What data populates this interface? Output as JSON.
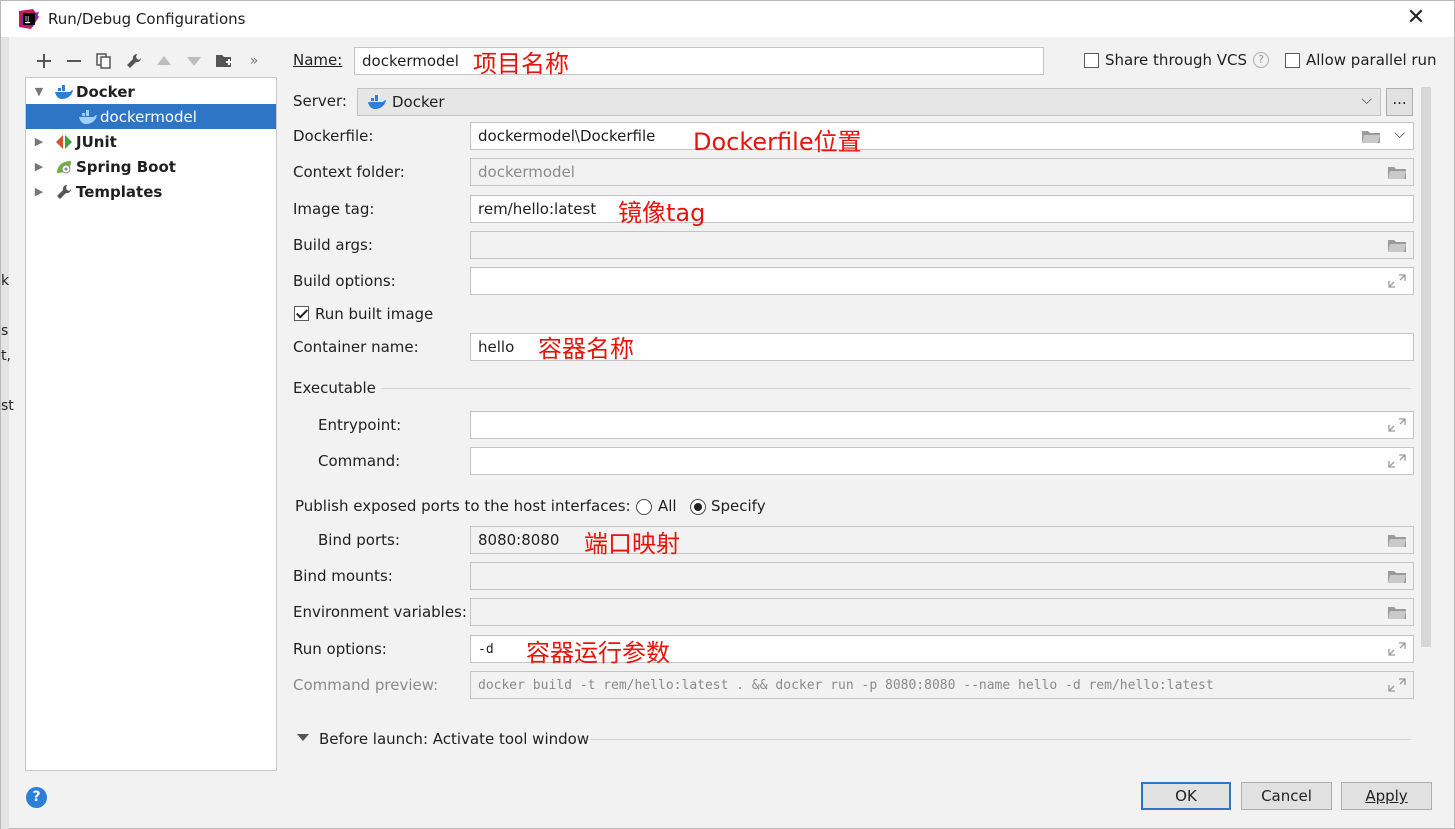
{
  "window": {
    "title": "Run/Debug Configurations"
  },
  "tree": {
    "items": [
      {
        "label": "Docker"
      },
      {
        "label": "dockermodel"
      },
      {
        "label": "JUnit"
      },
      {
        "label": "Spring Boot"
      },
      {
        "label": "Templates"
      }
    ]
  },
  "header": {
    "name_label": "Name:",
    "name_value": "dockermodel",
    "share_label": "Share through VCS",
    "parallel_label": "Allow parallel run"
  },
  "form": {
    "server_label": "Server:",
    "server_value": "Docker",
    "dockerfile_label": "Dockerfile:",
    "dockerfile_value": "dockermodel\\Dockerfile",
    "context_label": "Context folder:",
    "context_value": "dockermodel",
    "imagetag_label": "Image tag:",
    "imagetag_value": "rem/hello:latest",
    "buildargs_label": "Build args:",
    "buildoptions_label": "Build options:",
    "runbuilt_label": "Run built image",
    "container_label": "Container name:",
    "container_value": "hello",
    "executable_label": "Executable",
    "entrypoint_label": "Entrypoint:",
    "command_label": "Command:",
    "publish_label": "Publish exposed ports to the host interfaces:",
    "radio_all": "All",
    "radio_specify": "Specify",
    "bindports_label": "Bind ports:",
    "bindports_value": "8080:8080",
    "bindmounts_label": "Bind mounts:",
    "envvars_label": "Environment variables:",
    "runoptions_label": "Run options:",
    "runoptions_value": "-d",
    "preview_label": "Command preview:",
    "preview_value": "docker build -t rem/hello:latest . && docker run -p 8080:8080 --name hello -d rem/hello:latest",
    "before_launch_label": "Before launch: Activate tool window",
    "more_button": "..."
  },
  "annotations": {
    "name": "项目名称",
    "dockerfile": "Dockerfile位置",
    "imagetag": "镜像tag",
    "container": "容器名称",
    "bindports": "端口映射",
    "runoptions": "容器运行参数"
  },
  "buttons": {
    "ok": "OK",
    "cancel": "Cancel",
    "apply": "Apply",
    "help": "?"
  },
  "background_snippets": [
    "k",
    "s",
    "t,",
    "st"
  ],
  "colors": {
    "selection": "#2f75c6",
    "annotation": "#e8140c",
    "help": "#2b7fd6"
  }
}
